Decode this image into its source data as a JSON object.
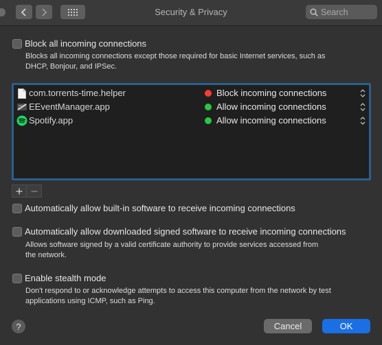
{
  "window": {
    "title": "Security & Privacy",
    "search_placeholder": "Search"
  },
  "block_all": {
    "label": "Block all incoming connections",
    "description_line1": "Blocks all incoming connections except those required for basic Internet services, such as",
    "description_line2": "DHCP, Bonjour, and IPSec.",
    "checked": false
  },
  "apps": [
    {
      "name": "com.torrents-time.helper",
      "icon": "document-icon",
      "status": "Block incoming connections",
      "status_color": "#ff3b30"
    },
    {
      "name": "EEventManager.app",
      "icon": "eevent-app-icon",
      "status": "Allow incoming connections",
      "status_color": "#28c840"
    },
    {
      "name": "Spotify.app",
      "icon": "spotify-icon",
      "status": "Allow incoming connections",
      "status_color": "#28c840"
    }
  ],
  "list_controls": {
    "add": "+",
    "remove": "−"
  },
  "auto_builtin": {
    "label": "Automatically allow built-in software to receive incoming connections",
    "checked": false
  },
  "auto_signed": {
    "label": "Automatically allow downloaded signed software to receive incoming connections",
    "description_line1": "Allows software signed by a valid certificate authority to provide services accessed from",
    "description_line2": "the network.",
    "checked": false
  },
  "stealth": {
    "label": "Enable stealth mode",
    "description_line1": "Don't respond to or acknowledge attempts to access this computer from the network by test",
    "description_line2": "applications using ICMP, such as Ping.",
    "checked": false
  },
  "footer": {
    "help": "?",
    "cancel": "Cancel",
    "ok": "OK"
  },
  "colors": {
    "accent": "#1a6fe5",
    "list_border": "#2a5f8f",
    "block_dot": "#ff3b30",
    "allow_dot": "#28c840"
  }
}
